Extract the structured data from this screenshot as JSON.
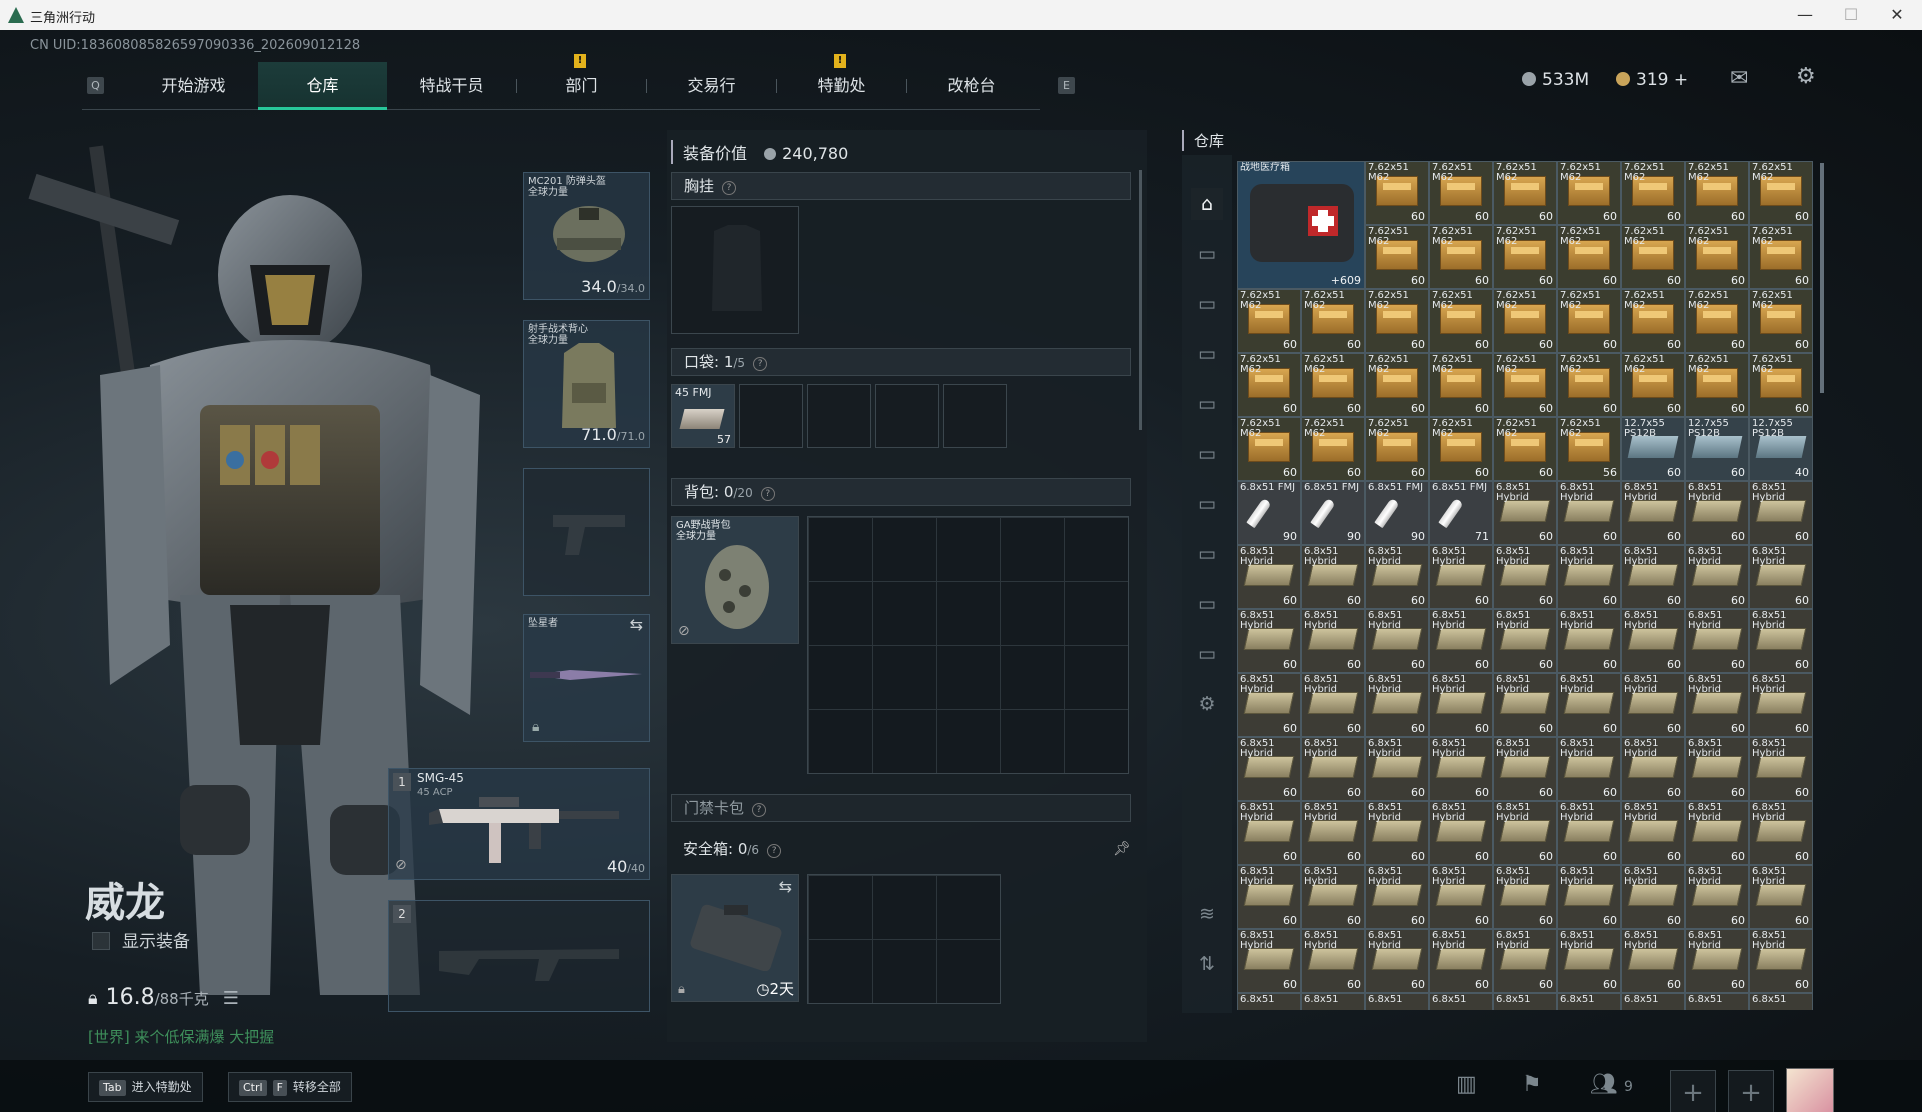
{
  "window": {
    "title": "三角洲行动",
    "minimize": "—",
    "maximize": "☐",
    "close": "✕"
  },
  "uid": "CN UID:18360808582659709033­6_202609012128",
  "nav": {
    "key_left": "Q",
    "key_right": "E",
    "tabs": [
      "开始游戏",
      "仓库",
      "特战干员",
      "部门",
      "交易行",
      "特勤处",
      "改枪台"
    ],
    "active": "仓库",
    "alert_badges": [
      "部门",
      "特勤处"
    ],
    "badge_text": "!"
  },
  "currency": {
    "silver": "533M",
    "gold": "319",
    "plus": "+",
    "silver_color": "#9aa3a9",
    "gold_color": "#c9a45a"
  },
  "operator": {
    "name": "威龙",
    "show_gear_label": "显示装备",
    "weight": "16.8",
    "weight_max": "/88千克",
    "chat": "[世界] 来个低保满爆 大把握"
  },
  "gear": {
    "helmet": {
      "name": "MC201 防弹头盔",
      "tag": "全球力量",
      "dur": "34.0",
      "max": "/34.0"
    },
    "armor": {
      "name": "射手战术背心",
      "tag": "全球力量",
      "dur": "71.0",
      "max": "/71.0"
    },
    "melee": {
      "name": "坠星者"
    },
    "primary1": {
      "slot": "1",
      "name": "SMG-45",
      "sub": "45 ACP",
      "ammo": "40",
      "ammo_max": "/40"
    },
    "primary2": {
      "slot": "2"
    }
  },
  "equipment": {
    "value_label": "装备价值",
    "value": "240,780",
    "chest_label": "胸挂",
    "help": "?",
    "pocket_label": "口袋:",
    "pocket_used": "1",
    "pocket_cap": "/5",
    "pocket_item": {
      "name": "45 FMJ",
      "count": "57"
    },
    "backpack_label": "背包:",
    "backpack_used": "0",
    "backpack_cap": "/20",
    "backpack_item": {
      "name": "GA野战背包",
      "tag": "全球力量"
    },
    "keycard_label": "门禁卡包",
    "safebox_label": "安全箱:",
    "safebox_used": "0",
    "safebox_cap": "/6",
    "safebox_timer": "2天"
  },
  "warehouse": {
    "title": "仓库",
    "medkit": {
      "name": "战地医疗箱",
      "count": "+609"
    },
    "rows": [
      [
        {
          "l": "7.62x51 M62",
          "c": "60",
          "t": "g"
        },
        {
          "l": "7.62x51 M62",
          "c": "60",
          "t": "g"
        },
        {
          "l": "7.62x51 M62",
          "c": "60",
          "t": "g"
        },
        {
          "l": "7.62x51 M62",
          "c": "60",
          "t": "g"
        },
        {
          "l": "7.62x51 M62",
          "c": "60",
          "t": "g"
        },
        {
          "l": "7.62x51 M62",
          "c": "60",
          "t": "g"
        },
        {
          "l": "7.62x51 M62",
          "c": "60",
          "t": "g"
        }
      ],
      [
        {
          "l": "7.62x51 M62",
          "c": "60",
          "t": "g"
        },
        {
          "l": "7.62x51 M62",
          "c": "60",
          "t": "g"
        },
        {
          "l": "7.62x51 M62",
          "c": "60",
          "t": "g"
        },
        {
          "l": "7.62x51 M62",
          "c": "60",
          "t": "g"
        },
        {
          "l": "7.62x51 M62",
          "c": "60",
          "t": "g"
        },
        {
          "l": "7.62x51 M62",
          "c": "60",
          "t": "g"
        },
        {
          "l": "7.62x51 M62",
          "c": "60",
          "t": "g"
        }
      ],
      [
        {
          "l": "7.62x51 M62",
          "c": "60",
          "t": "g"
        },
        {
          "l": "7.62x51 M62",
          "c": "60",
          "t": "g"
        },
        {
          "l": "7.62x51 M62",
          "c": "60",
          "t": "g"
        },
        {
          "l": "7.62x51 M62",
          "c": "60",
          "t": "g"
        },
        {
          "l": "7.62x51 M62",
          "c": "60",
          "t": "g"
        },
        {
          "l": "7.62x51 M62",
          "c": "60",
          "t": "g"
        },
        {
          "l": "7.62x51 M62",
          "c": "60",
          "t": "g"
        },
        {
          "l": "7.62x51 M62",
          "c": "60",
          "t": "g"
        },
        {
          "l": "7.62x51 M62",
          "c": "60",
          "t": "g"
        }
      ],
      [
        {
          "l": "7.62x51 M62",
          "c": "60",
          "t": "g"
        },
        {
          "l": "7.62x51 M62",
          "c": "60",
          "t": "g"
        },
        {
          "l": "7.62x51 M62",
          "c": "60",
          "t": "g"
        },
        {
          "l": "7.62x51 M62",
          "c": "60",
          "t": "g"
        },
        {
          "l": "7.62x51 M62",
          "c": "60",
          "t": "g"
        },
        {
          "l": "7.62x51 M62",
          "c": "60",
          "t": "g"
        },
        {
          "l": "7.62x51 M62",
          "c": "60",
          "t": "g"
        },
        {
          "l": "7.62x51 M62",
          "c": "60",
          "t": "g"
        },
        {
          "l": "7.62x51 M62",
          "c": "60",
          "t": "g"
        }
      ],
      [
        {
          "l": "7.62x51 M62",
          "c": "60",
          "t": "g"
        },
        {
          "l": "7.62x51 M62",
          "c": "60",
          "t": "g"
        },
        {
          "l": "7.62x51 M62",
          "c": "60",
          "t": "g"
        },
        {
          "l": "7.62x51 M62",
          "c": "60",
          "t": "g"
        },
        {
          "l": "7.62x51 M62",
          "c": "60",
          "t": "g"
        },
        {
          "l": "7.62x51 M62",
          "c": "56",
          "t": "g"
        },
        {
          "l": "12.7x55 PS12B",
          "c": "60",
          "t": "t"
        },
        {
          "l": "12.7x55 PS12B",
          "c": "60",
          "t": "t"
        },
        {
          "l": "12.7x55 PS12B",
          "c": "40",
          "t": "t"
        }
      ],
      [
        {
          "l": "6.8x51 FMJ",
          "c": "90",
          "t": "s"
        },
        {
          "l": "6.8x51 FMJ",
          "c": "90",
          "t": "s"
        },
        {
          "l": "6.8x51 FMJ",
          "c": "90",
          "t": "s"
        },
        {
          "l": "6.8x51 FMJ",
          "c": "71",
          "t": "s"
        },
        {
          "l": "6.8x51 Hybrid",
          "c": "60",
          "t": "o"
        },
        {
          "l": "6.8x51 Hybrid",
          "c": "60",
          "t": "o"
        },
        {
          "l": "6.8x51 Hybrid",
          "c": "60",
          "t": "o"
        },
        {
          "l": "6.8x51 Hybrid",
          "c": "60",
          "t": "o"
        },
        {
          "l": "6.8x51 Hybrid",
          "c": "60",
          "t": "o"
        }
      ],
      [
        {
          "l": "6.8x51 Hybrid",
          "c": "60",
          "t": "o"
        },
        {
          "l": "6.8x51 Hybrid",
          "c": "60",
          "t": "o"
        },
        {
          "l": "6.8x51 Hybrid",
          "c": "60",
          "t": "o"
        },
        {
          "l": "6.8x51 Hybrid",
          "c": "60",
          "t": "o"
        },
        {
          "l": "6.8x51 Hybrid",
          "c": "60",
          "t": "o"
        },
        {
          "l": "6.8x51 Hybrid",
          "c": "60",
          "t": "o"
        },
        {
          "l": "6.8x51 Hybrid",
          "c": "60",
          "t": "o"
        },
        {
          "l": "6.8x51 Hybrid",
          "c": "60",
          "t": "o"
        },
        {
          "l": "6.8x51 Hybrid",
          "c": "60",
          "t": "o"
        }
      ],
      [
        {
          "l": "6.8x51 Hybrid",
          "c": "60",
          "t": "o"
        },
        {
          "l": "6.8x51 Hybrid",
          "c": "60",
          "t": "o"
        },
        {
          "l": "6.8x51 Hybrid",
          "c": "60",
          "t": "o"
        },
        {
          "l": "6.8x51 Hybrid",
          "c": "60",
          "t": "o"
        },
        {
          "l": "6.8x51 Hybrid",
          "c": "60",
          "t": "o"
        },
        {
          "l": "6.8x51 Hybrid",
          "c": "60",
          "t": "o"
        },
        {
          "l": "6.8x51 Hybrid",
          "c": "60",
          "t": "o"
        },
        {
          "l": "6.8x51 Hybrid",
          "c": "60",
          "t": "o"
        },
        {
          "l": "6.8x51 Hybrid",
          "c": "60",
          "t": "o"
        }
      ],
      [
        {
          "l": "6.8x51 Hybrid",
          "c": "60",
          "t": "o"
        },
        {
          "l": "6.8x51 Hybrid",
          "c": "60",
          "t": "o"
        },
        {
          "l": "6.8x51 Hybrid",
          "c": "60",
          "t": "o"
        },
        {
          "l": "6.8x51 Hybrid",
          "c": "60",
          "t": "o"
        },
        {
          "l": "6.8x51 Hybrid",
          "c": "60",
          "t": "o"
        },
        {
          "l": "6.8x51 Hybrid",
          "c": "60",
          "t": "o"
        },
        {
          "l": "6.8x51 Hybrid",
          "c": "60",
          "t": "o"
        },
        {
          "l": "6.8x51 Hybrid",
          "c": "60",
          "t": "o"
        },
        {
          "l": "6.8x51 Hybrid",
          "c": "60",
          "t": "o"
        }
      ],
      [
        {
          "l": "6.8x51 Hybrid",
          "c": "60",
          "t": "o"
        },
        {
          "l": "6.8x51 Hybrid",
          "c": "60",
          "t": "o"
        },
        {
          "l": "6.8x51 Hybrid",
          "c": "60",
          "t": "o"
        },
        {
          "l": "6.8x51 Hybrid",
          "c": "60",
          "t": "o"
        },
        {
          "l": "6.8x51 Hybrid",
          "c": "60",
          "t": "o"
        },
        {
          "l": "6.8x51 Hybrid",
          "c": "60",
          "t": "o"
        },
        {
          "l": "6.8x51 Hybrid",
          "c": "60",
          "t": "o"
        },
        {
          "l": "6.8x51 Hybrid",
          "c": "60",
          "t": "o"
        },
        {
          "l": "6.8x51 Hybrid",
          "c": "60",
          "t": "o"
        }
      ],
      [
        {
          "l": "6.8x51 Hybrid",
          "c": "60",
          "t": "o"
        },
        {
          "l": "6.8x51 Hybrid",
          "c": "60",
          "t": "o"
        },
        {
          "l": "6.8x51 Hybrid",
          "c": "60",
          "t": "o"
        },
        {
          "l": "6.8x51 Hybrid",
          "c": "60",
          "t": "o"
        },
        {
          "l": "6.8x51 Hybrid",
          "c": "60",
          "t": "o"
        },
        {
          "l": "6.8x51 Hybrid",
          "c": "60",
          "t": "o"
        },
        {
          "l": "6.8x51 Hybrid",
          "c": "60",
          "t": "o"
        },
        {
          "l": "6.8x51 Hybrid",
          "c": "60",
          "t": "o"
        },
        {
          "l": "6.8x51 Hybrid",
          "c": "60",
          "t": "o"
        }
      ],
      [
        {
          "l": "6.8x51 Hybrid",
          "c": "60",
          "t": "o"
        },
        {
          "l": "6.8x51 Hybrid",
          "c": "60",
          "t": "o"
        },
        {
          "l": "6.8x51 Hybrid",
          "c": "60",
          "t": "o"
        },
        {
          "l": "6.8x51 Hybrid",
          "c": "60",
          "t": "o"
        },
        {
          "l": "6.8x51 Hybrid",
          "c": "60",
          "t": "o"
        },
        {
          "l": "6.8x51 Hybrid",
          "c": "60",
          "t": "o"
        },
        {
          "l": "6.8x51 Hybrid",
          "c": "60",
          "t": "o"
        },
        {
          "l": "6.8x51 Hybrid",
          "c": "60",
          "t": "o"
        },
        {
          "l": "6.8x51 Hybrid",
          "c": "60",
          "t": "o"
        }
      ],
      [
        {
          "l": "6.8x51 Hybrid",
          "c": "60",
          "t": "o"
        },
        {
          "l": "6.8x51 Hybrid",
          "c": "60",
          "t": "o"
        },
        {
          "l": "6.8x51 Hybrid",
          "c": "60",
          "t": "o"
        },
        {
          "l": "6.8x51 Hybrid",
          "c": "60",
          "t": "o"
        },
        {
          "l": "6.8x51 Hybrid",
          "c": "60",
          "t": "o"
        },
        {
          "l": "6.8x51 Hybrid",
          "c": "60",
          "t": "o"
        },
        {
          "l": "6.8x51 Hybrid",
          "c": "60",
          "t": "o"
        },
        {
          "l": "6.8x51 Hybrid",
          "c": "60",
          "t": "o"
        },
        {
          "l": "6.8x51 Hybrid",
          "c": "60",
          "t": "o"
        }
      ],
      [
        {
          "l": "6.8x51",
          "c": "",
          "t": "o"
        },
        {
          "l": "6.8x51",
          "c": "",
          "t": "o"
        },
        {
          "l": "6.8x51",
          "c": "",
          "t": "o"
        },
        {
          "l": "6.8x51",
          "c": "",
          "t": "o"
        },
        {
          "l": "6.8x51",
          "c": "",
          "t": "o"
        },
        {
          "l": "6.8x51",
          "c": "",
          "t": "o"
        },
        {
          "l": "6.8x51",
          "c": "",
          "t": "o"
        },
        {
          "l": "6.8x51",
          "c": "",
          "t": "o"
        },
        {
          "l": "6.8x51",
          "c": "",
          "t": "o"
        }
      ]
    ]
  },
  "bottom": {
    "enter_label": "进入特勤处",
    "enter_key": "Tab",
    "transfer_label": "转移全部",
    "transfer_key1": "Ctrl",
    "transfer_key2": "F",
    "friends_count": "9"
  }
}
